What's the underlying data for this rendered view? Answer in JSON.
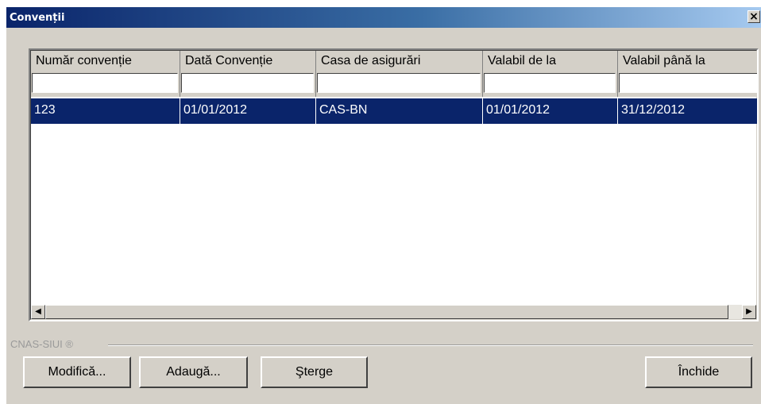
{
  "window": {
    "title": "Convenții",
    "close_glyph": "×"
  },
  "grid": {
    "columns": [
      "Număr convenție",
      "Dată Convenție",
      "Casa de asigurări",
      "Valabil de la",
      "Valabil până la"
    ],
    "rows": [
      [
        "123",
        "01/01/2012",
        "CAS-BN",
        "01/01/2012",
        "31/12/2012"
      ]
    ],
    "filters": [
      "",
      "",
      "",
      "",
      ""
    ]
  },
  "scrollbar": {
    "left_arrow": "◀",
    "right_arrow": "▶"
  },
  "brand": "CNAS-SIUI ®",
  "buttons": {
    "modify": "Modifică...",
    "add": "Adaugă...",
    "delete": "Şterge",
    "close": "Închide"
  },
  "colors": {
    "selected_row": "#0a246a",
    "titlebar_start": "#0a246a",
    "titlebar_end": "#a6caf0",
    "window_bg": "#d4d0c8"
  }
}
